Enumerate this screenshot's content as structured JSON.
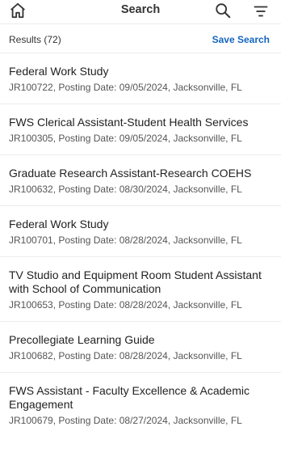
{
  "header": {
    "title": "Search",
    "home_icon": "home-icon",
    "search_icon": "search-icon",
    "filter_icon": "filter-icon"
  },
  "results": {
    "count_label": "Results (72)",
    "save_label": "Save Search"
  },
  "jobs": [
    {
      "title": "Federal Work Study",
      "meta": "JR100722, Posting Date: 09/05/2024, Jacksonville, FL"
    },
    {
      "title": "FWS Clerical Assistant-Student Health Services",
      "meta": "JR100305, Posting Date: 09/05/2024, Jacksonville, FL"
    },
    {
      "title": "Graduate Research Assistant-Research COEHS",
      "meta": "JR100632, Posting Date: 08/30/2024, Jacksonville, FL"
    },
    {
      "title": "Federal Work Study",
      "meta": "JR100701, Posting Date: 08/28/2024, Jacksonville, FL"
    },
    {
      "title": "TV Studio and Equipment Room Student Assistant with School of Communication",
      "meta": "JR100653, Posting Date: 08/28/2024, Jacksonville, FL"
    },
    {
      "title": "Precollegiate Learning Guide",
      "meta": "JR100682, Posting Date: 08/28/2024, Jacksonville, FL"
    },
    {
      "title": "FWS Assistant - Faculty Excellence & Academic Engagement",
      "meta": "JR100679, Posting Date: 08/27/2024, Jacksonville, FL"
    }
  ],
  "colors": {
    "accent": "#1565c0",
    "divider": "#ececec"
  }
}
